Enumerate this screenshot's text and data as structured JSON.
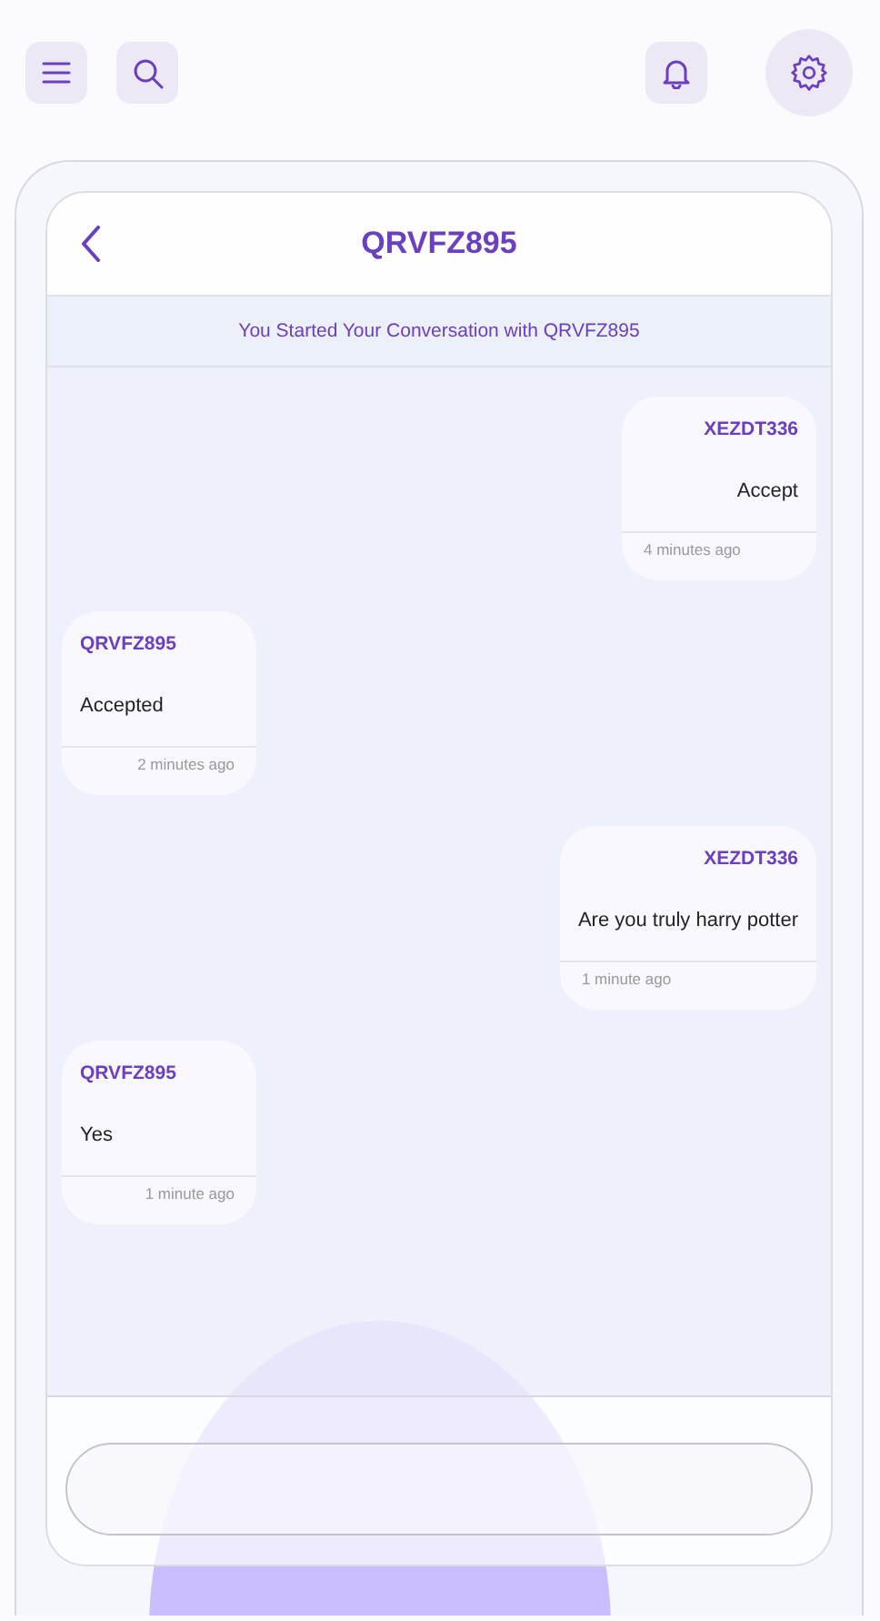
{
  "chat": {
    "title": "QRVFZ895",
    "notice": "You Started Your Conversation with QRVFZ895",
    "messages": [
      {
        "sender": "XEZDT336",
        "text": "Accept",
        "time": "4 minutes ago",
        "outgoing": true
      },
      {
        "sender": "QRVFZ895",
        "text": "Accepted",
        "time": "2 minutes ago",
        "outgoing": false
      },
      {
        "sender": "XEZDT336",
        "text": "Are you truly harry potter",
        "time": "1 minute ago",
        "outgoing": true
      },
      {
        "sender": "QRVFZ895",
        "text": "Yes",
        "time": "1 minute ago",
        "outgoing": false
      }
    ]
  }
}
